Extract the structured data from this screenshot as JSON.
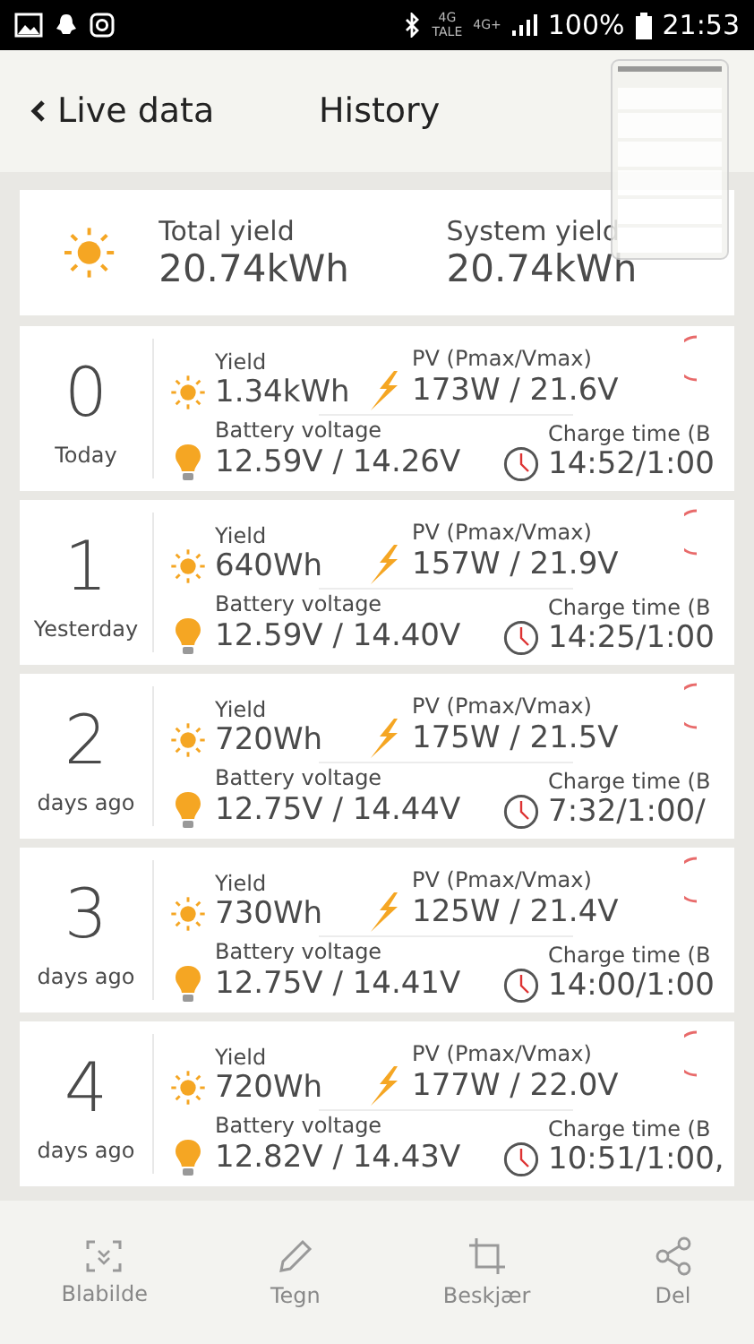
{
  "status_bar": {
    "network": [
      "4G",
      "TALE",
      "4G+"
    ],
    "battery": "100%",
    "time": "21:53"
  },
  "header": {
    "back_label": "Live data",
    "title": "History"
  },
  "summary": [
    {
      "label": "Total yield",
      "value": "20.74kWh"
    },
    {
      "label": "System yield",
      "value": "20.74kWh"
    }
  ],
  "days": [
    {
      "number": "0",
      "label": "Today",
      "yield_label": "Yield",
      "yield": "1.34kWh",
      "pv_label": "PV (Pmax/Vmax)",
      "pv": "173W / 21.6V",
      "battery_label": "Battery voltage",
      "battery": "12.59V / 14.26V",
      "charge_label": "Charge time (B",
      "charge": "14:52/1:00"
    },
    {
      "number": "1",
      "label": "Yesterday",
      "yield_label": "Yield",
      "yield": "640Wh",
      "pv_label": "PV (Pmax/Vmax)",
      "pv": "157W / 21.9V",
      "battery_label": "Battery voltage",
      "battery": "12.59V / 14.40V",
      "charge_label": "Charge time (B",
      "charge": "14:25/1:00"
    },
    {
      "number": "2",
      "label": "days ago",
      "yield_label": "Yield",
      "yield": "720Wh",
      "pv_label": "PV (Pmax/Vmax)",
      "pv": "175W / 21.5V",
      "battery_label": "Battery voltage",
      "battery": "12.75V / 14.44V",
      "charge_label": "Charge time (B",
      "charge": "7:32/1:00/"
    },
    {
      "number": "3",
      "label": "days ago",
      "yield_label": "Yield",
      "yield": "730Wh",
      "pv_label": "PV (Pmax/Vmax)",
      "pv": "125W / 21.4V",
      "battery_label": "Battery voltage",
      "battery": "12.75V / 14.41V",
      "charge_label": "Charge time (B",
      "charge": "14:00/1:00"
    },
    {
      "number": "4",
      "label": "days ago",
      "yield_label": "Yield",
      "yield": "720Wh",
      "pv_label": "PV (Pmax/Vmax)",
      "pv": "177W / 22.0V",
      "battery_label": "Battery voltage",
      "battery": "12.82V / 14.43V",
      "charge_label": "Charge time (B",
      "charge": "10:51/1:00,"
    }
  ],
  "screenshot_toolbar": [
    {
      "kind": "scroll",
      "label": "Blabilde"
    },
    {
      "kind": "draw",
      "label": "Tegn"
    },
    {
      "kind": "crop",
      "label": "Beskjær"
    },
    {
      "kind": "share",
      "label": "Del"
    }
  ]
}
